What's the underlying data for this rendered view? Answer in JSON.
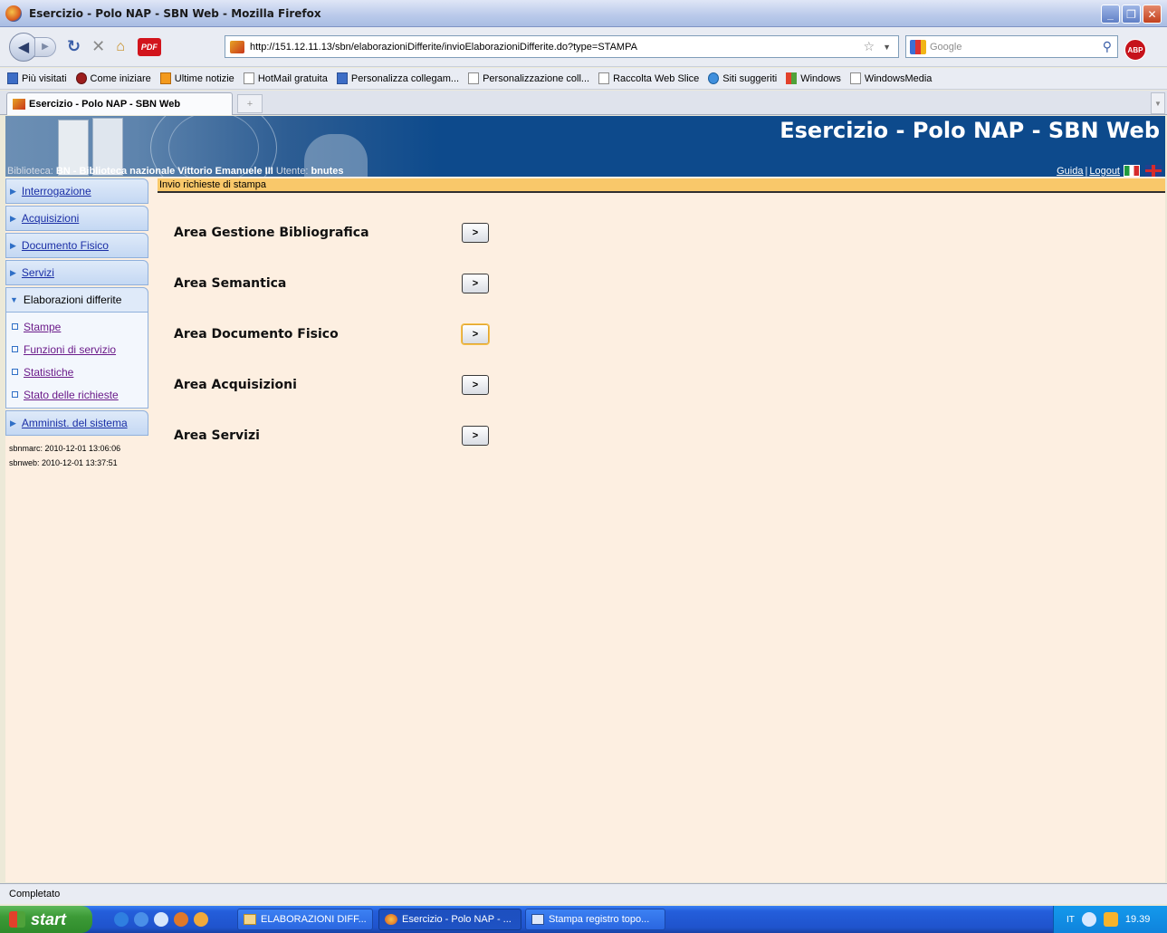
{
  "window": {
    "title": "Esercizio - Polo NAP - SBN Web - Mozilla Firefox"
  },
  "toolbar": {
    "url": "http://151.12.11.13/sbn/elaborazioniDifferite/invioElaborazioniDifferite.do?type=STAMPA",
    "search_placeholder": "Google",
    "pdf_label": "PDF",
    "abp_label": "ABP"
  },
  "bookmarks": [
    {
      "label": "Più visitati",
      "icon": "most-visited-icon"
    },
    {
      "label": "Come iniziare",
      "icon": "firefox-icon"
    },
    {
      "label": "Ultime notizie",
      "icon": "rss-icon"
    },
    {
      "label": "HotMail gratuita",
      "icon": "page-icon"
    },
    {
      "label": "Personalizza collegam...",
      "icon": "msn-icon"
    },
    {
      "label": "Personalizzazione coll...",
      "icon": "page-icon"
    },
    {
      "label": "Raccolta Web Slice",
      "icon": "page-icon"
    },
    {
      "label": "Siti suggeriti",
      "icon": "ie-icon"
    },
    {
      "label": "Windows",
      "icon": "windows-icon"
    },
    {
      "label": "WindowsMedia",
      "icon": "page-icon"
    }
  ],
  "tab": {
    "label": "Esercizio - Polo NAP - SBN Web",
    "new_tab": "+"
  },
  "header": {
    "app_title": "Esercizio - Polo NAP - SBN Web",
    "biblioteca_label": "Biblioteca:",
    "biblioteca_value": "BN - Biblioteca nazionale Vittorio Emanuele III",
    "utente_label": "Utente:",
    "utente_value": "bnutes",
    "guida": "Guida",
    "separator": "|",
    "logout": "Logout"
  },
  "sidebar": {
    "items": [
      {
        "label": "Interrogazione"
      },
      {
        "label": "Acquisizioni"
      },
      {
        "label": "Documento Fisico"
      },
      {
        "label": "Servizi"
      },
      {
        "label": "Elaborazioni differite"
      }
    ],
    "subitems": [
      {
        "label": "Stampe"
      },
      {
        "label": "Funzioni di servizio"
      },
      {
        "label": "Statistiche"
      },
      {
        "label": "Stato delle richieste"
      }
    ],
    "last_item": "Amminist. del sistema",
    "sysinfo": [
      "sbnmarc:  2010-12-01 13:06:06",
      "sbnweb:   2010-12-01 13:37:51"
    ]
  },
  "main": {
    "crumb": "Invio richieste di stampa",
    "areas": [
      {
        "label": "Area Gestione Bibliografica",
        "button": ">"
      },
      {
        "label": "Area Semantica",
        "button": ">"
      },
      {
        "label": "Area Documento Fisico",
        "button": ">"
      },
      {
        "label": "Area Acquisizioni",
        "button": ">"
      },
      {
        "label": "Area Servizi",
        "button": ">"
      }
    ]
  },
  "status": {
    "text": "Completato"
  },
  "taskbar": {
    "start": "start",
    "tasks": [
      {
        "label": "ELABORAZIONI DIFF..."
      },
      {
        "label": "Esercizio - Polo NAP - ..."
      },
      {
        "label": "Stampa registro topo..."
      }
    ],
    "lang": "IT",
    "clock": "19.39"
  }
}
